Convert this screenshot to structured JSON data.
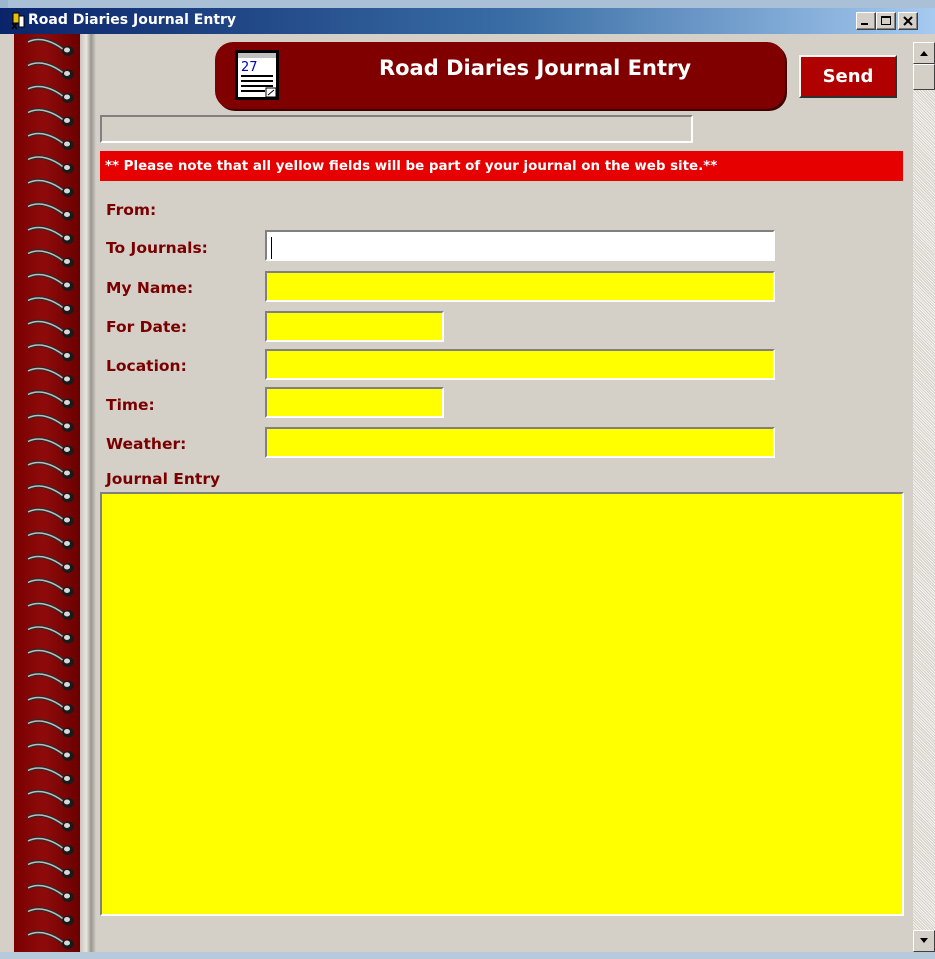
{
  "window": {
    "title": "Road Diaries Journal Entry",
    "controls": [
      "minimize",
      "maximize",
      "close"
    ]
  },
  "header": {
    "title": "Road Diaries Journal Entry",
    "calendar_day": "27",
    "send_label": "Send"
  },
  "status_field": {
    "value": ""
  },
  "notice": "** Please note that all yellow fields will be part of your journal on the web site.**",
  "form": {
    "from_label": "From:",
    "to_journals_label": "To Journals:",
    "to_journals_value": "",
    "my_name_label": "My Name:",
    "my_name_value": "",
    "for_date_label": "For Date:",
    "for_date_value": "",
    "location_label": "Location:",
    "location_value": "",
    "time_label": "Time:",
    "time_value": "",
    "weather_label": "Weather:",
    "weather_value": "",
    "journal_entry_label": "Journal Entry",
    "journal_entry_value": ""
  },
  "colors": {
    "title_bar": "#0a246a",
    "brand_maroon": "#800000",
    "notice_red": "#e60000",
    "journal_field_yellow": "#ffff00",
    "label_color": "#7a0000",
    "window_face": "#d4d0c8"
  },
  "icons": {
    "title_icon": "app-logo-icon",
    "header_icon": "calendar-notepad-icon",
    "minimize": "minimize-icon",
    "maximize": "maximize-icon",
    "close": "close-icon",
    "scroll_up": "arrow-up-icon",
    "scroll_down": "arrow-down-icon"
  }
}
